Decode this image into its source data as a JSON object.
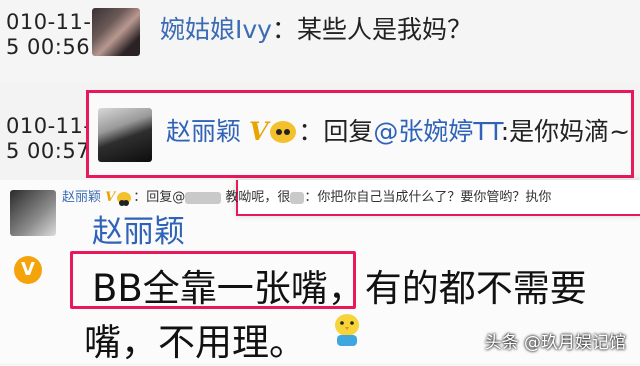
{
  "row1": {
    "time_line1": "010-11-",
    "time_line2": "5 00:56",
    "name": "婉姑娘Ivy",
    "text": "：某些人是我妈？"
  },
  "row2": {
    "time_line1": "010-11-",
    "time_line2": "5 00:57",
    "name": "赵丽颖",
    "verified": "V",
    "reply_prefix": "：回复",
    "mention": "@张婉婷TT",
    "text": ":是你妈滴~"
  },
  "lower": {
    "small_name": "赵丽颖",
    "small_verified": "V",
    "small_reply": "：回复@",
    "small_text": "：你把你自己当成什么了？要你管哟？执你",
    "mid_text": "教呦呢，很",
    "big_name": "赵丽颖",
    "vip_letter": "V",
    "msg_boxed": "BB全靠一张嘴",
    "msg_rest": "，有的都不需要",
    "msg_line2": "嘴，不用理。"
  },
  "watermark": "头条 @玖月娱记馆",
  "colors": {
    "highlight": "#e8195a",
    "name_blue": "#2f63b7",
    "verified_gold": "#e8a400"
  }
}
